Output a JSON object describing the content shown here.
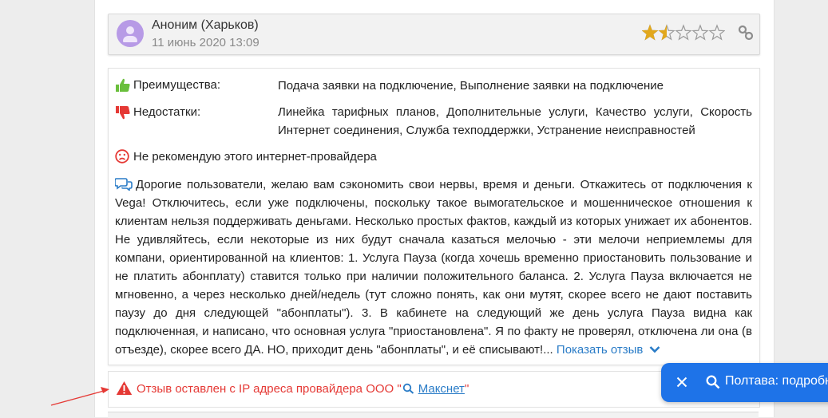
{
  "review": {
    "author": "Аноним (Харьков)",
    "date": "11 июнь 2020 13:09",
    "rating": 1.5,
    "rating_max": 5,
    "advantages_label": "Преимущества:",
    "advantages_text": "Подача заявки на подключение, Выполнение заявки на подключение",
    "disadvantages_label": "Недостатки:",
    "disadvantages_text": "Линейка тарифных планов, Дополнительные услуги, Качество услуги, Скорость Интернет соединения, Служба техподдержки, Устранение неисправностей",
    "recommendation": "Не рекомендую этого интернет-провайдера",
    "text": "Дорогие пользователи, желаю вам сэкономить свои нервы, время и деньги. Откажитесь от подключения к Vega! Отключитесь, если уже подключены, поскольку такое вымогательское и мошенническое отношения к клиентам нельзя поддерживать деньгами. Несколько простых фактов, каждый из которых унижает их абонентов. Не удивляйтесь, если некоторые из них будут сначала казаться мелочью - эти мелочи неприемлемы для компани, ориентированной на клиентов: 1. Услуга Пауза (когда хочешь временно приостановить пользование и не платить абонплату) ставится только при наличии положительного баланса. 2. Услуга Пауза включается не мгновенно, а через несколько дней/недель (тут сложно понять, как они мутят, скорее всего не дают поставить паузу до дня следующей \"абонплаты\"). 3. В кабинете на следующий же день услуга Пауза видна как подключенная, и написано, что основная услуга \"приостановлена\". Я по факту не проверял, отключена ли она (в отъезде), скорее всего ДА. НО, приходит день \"абонплаты\", и её списывают!...",
    "show_more_label": "Показать отзыв"
  },
  "ip_notice": {
    "prefix": "Отзыв оставлен с IP адреса провайдера ООО \"",
    "provider": "Макснет",
    "suffix": "\""
  },
  "toast": {
    "text": "Полтава: подробн"
  },
  "colors": {
    "accent": "#1e73e8",
    "link": "#2a7cc7",
    "star": "#e2a81c",
    "warning": "#e53935",
    "thumb_up": "#6abf3c",
    "thumb_down": "#e53935"
  }
}
